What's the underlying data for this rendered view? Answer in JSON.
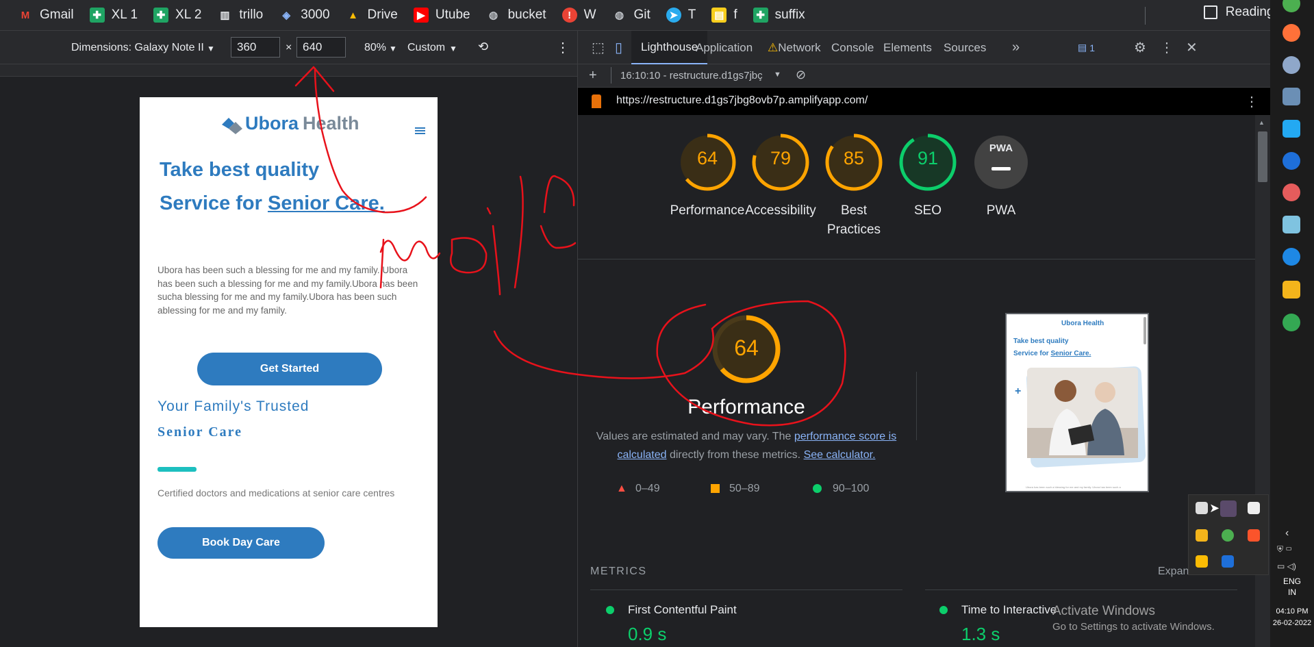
{
  "bookmarks": [
    {
      "label": "Gmail",
      "icon": "gmail-icon",
      "color": "#ea4335"
    },
    {
      "label": "XL 1",
      "icon": "sheets-icon",
      "color": "#1fa463"
    },
    {
      "label": "XL 2",
      "icon": "sheets-icon",
      "color": "#1fa463"
    },
    {
      "label": "trillo",
      "icon": "trillo-icon",
      "color": "#e8eaed"
    },
    {
      "label": "3000",
      "icon": "site-icon",
      "color": "#8ab4f8"
    },
    {
      "label": "Drive",
      "icon": "drive-icon",
      "color": "#fbbc04"
    },
    {
      "label": "Utube",
      "icon": "youtube-icon",
      "color": "#ff0000"
    },
    {
      "label": "bucket",
      "icon": "globe-icon",
      "color": "#bdc1c6"
    },
    {
      "label": "W",
      "icon": "warning-icon",
      "color": "#ea4335"
    },
    {
      "label": "Git",
      "icon": "globe-icon",
      "color": "#bdc1c6"
    },
    {
      "label": "T",
      "icon": "telegram-icon",
      "color": "#2aabee"
    },
    {
      "label": "f",
      "icon": "file-icon",
      "color": "#f9ce1d"
    },
    {
      "label": "suffix",
      "icon": "sheets-icon",
      "color": "#1fa463"
    }
  ],
  "reading_list": "Reading list",
  "device_toolbar": {
    "dimensions": "Dimensions: Galaxy Note II",
    "width": "360",
    "times": "×",
    "height": "640",
    "zoom": "80%",
    "throttle": "Custom"
  },
  "mobile": {
    "logo": "Ubora",
    "logo2": "Health",
    "headline1": "Take best quality",
    "headline2": "Service for ",
    "headline_link": "Senior Care.",
    "paragraph": "Ubora has been such a blessing for me and my family. Ubora has been such a blessing for me and my family.Ubora has been sucha blessing for me and my family.Ubora has been such ablessing for me and my family.",
    "cta": "Get Started",
    "sub1": "Your Family's Trusted",
    "sub2": "Senior Care",
    "cert": "Certified doctors and medications at senior care centres",
    "book": "Book Day Care"
  },
  "devtools": {
    "tabs": [
      "Lighthouse",
      "Application",
      "Network",
      "Console",
      "Elements",
      "Sources"
    ],
    "more": "»",
    "issues_count": "1",
    "report_time": "16:10:10 - restructure.d1gs7jbç",
    "url": "https://restructure.d1gs7jbg8ovb7p.amplifyapp.com/"
  },
  "scores": [
    {
      "value": "64",
      "label": "Performance",
      "score": 0.64,
      "color": "#ffa400"
    },
    {
      "value": "79",
      "label": "Accessibility",
      "score": 0.79,
      "color": "#ffa400"
    },
    {
      "value": "85",
      "label": "Best Practices",
      "score": 0.85,
      "color": "#ffa400"
    },
    {
      "value": "91",
      "label": "SEO",
      "score": 0.91,
      "color": "#0cce6b"
    },
    {
      "value": "PWA",
      "label": "PWA",
      "score": 0,
      "color": "#9aa0a6"
    }
  ],
  "perf": {
    "value": "64",
    "label": "Performance",
    "desc1": "Values are estimated and may vary. The ",
    "link1": "performance score is calculated",
    "desc2": " directly from these metrics. ",
    "link2": "See calculator.",
    "legend": [
      "0–49",
      "50–89",
      "90–100"
    ]
  },
  "thumbnail": {
    "logo": "Ubora Health",
    "line1": "Take best quality",
    "line2": "Service for ",
    "link": "Senior Care.",
    "footer": "Ubora has been such a blessing for me and my family. Ubora has been such a"
  },
  "metrics": {
    "heading": "METRICS",
    "expand": "Expan",
    "items": [
      {
        "label": "First Contentful Paint",
        "value": "0.9 s"
      },
      {
        "label": "Time to Interactive",
        "value": "1.3 s"
      }
    ]
  },
  "watermark": {
    "title": "Activate Windows",
    "sub": "Go to Settings to activate Windows."
  },
  "tray": {
    "lang1": "ENG",
    "lang2": "IN",
    "time": "04:10 PM",
    "date": "26-02-2022"
  },
  "annotation": {
    "text": "mobile"
  }
}
